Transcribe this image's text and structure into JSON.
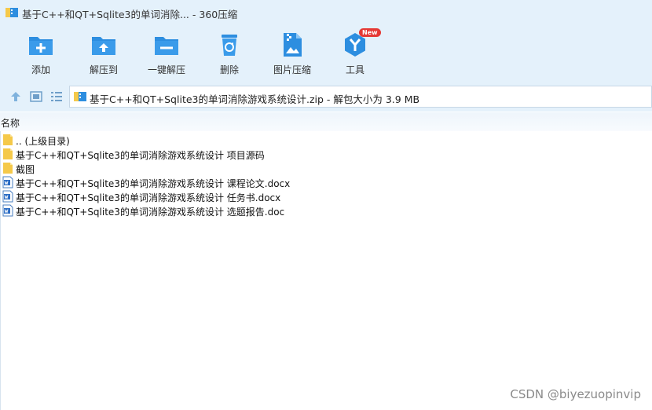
{
  "window": {
    "title": "基于C++和QT+Sqlite3的单词消除... - 360压缩"
  },
  "toolbar": {
    "items": [
      {
        "label": "添加",
        "icon": "add-folder-icon"
      },
      {
        "label": "解压到",
        "icon": "extract-to-icon"
      },
      {
        "label": "一键解压",
        "icon": "one-click-extract-icon"
      },
      {
        "label": "删除",
        "icon": "recycle-bin-icon"
      },
      {
        "label": "图片压缩",
        "icon": "image-compress-icon"
      },
      {
        "label": "工具",
        "icon": "tools-icon",
        "badge": "New"
      }
    ]
  },
  "address": {
    "path": "基于C++和QT+Sqlite3的单词消除游戏系统设计.zip - 解包大小为 3.9 MB"
  },
  "list": {
    "column_name": "名称",
    "rows": [
      {
        "name": ".. (上级目录)",
        "type": "folder"
      },
      {
        "name": "基于C++和QT+Sqlite3的单词消除游戏系统设计 项目源码",
        "type": "folder"
      },
      {
        "name": "截图",
        "type": "folder"
      },
      {
        "name": "基于C++和QT+Sqlite3的单词消除游戏系统设计 课程论文.docx",
        "type": "word"
      },
      {
        "name": "基于C++和QT+Sqlite3的单词消除游戏系统设计 任务书.docx",
        "type": "word"
      },
      {
        "name": "基于C++和QT+Sqlite3的单词消除游戏系统设计 选题报告.doc",
        "type": "word"
      }
    ]
  },
  "watermark": "CSDN @biyezuopinvip",
  "colors": {
    "toolbar_bg": "#e4f1fb",
    "icon_blue": "#2d8ee0",
    "folder_yellow": "#f5c94a",
    "badge_red": "#e53935"
  }
}
